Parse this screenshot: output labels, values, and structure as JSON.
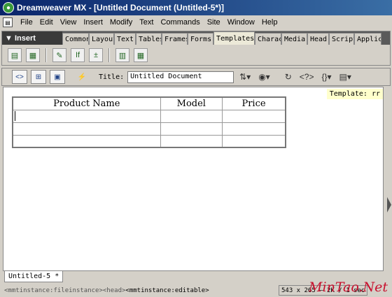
{
  "window": {
    "title": "Dreamweaver MX - [Untitled Document (Untitled-5*)]"
  },
  "menu": [
    "File",
    "Edit",
    "View",
    "Insert",
    "Modify",
    "Text",
    "Commands",
    "Site",
    "Window",
    "Help"
  ],
  "insert_panel": {
    "label": "Insert",
    "tabs": [
      "Common",
      "Layout",
      "Text",
      "Tables",
      "Frames",
      "Forms",
      "Templates",
      "Characters",
      "Media",
      "Head",
      "Script",
      "Application"
    ],
    "active_tab": "Templates",
    "icons": [
      "make-template-icon",
      "make-nested-template-icon",
      "editable-region-icon",
      "optional-region-icon",
      "repeating-region-icon",
      "editable-optional-region-icon",
      "repeating-table-icon"
    ]
  },
  "doc_toolbar": {
    "views": [
      "code-view-icon",
      "split-view-icon",
      "design-view-icon"
    ],
    "title_label": "Title:",
    "title_value": "Untitled Document"
  },
  "document": {
    "template_label": "Template: rr",
    "table": {
      "headers": [
        "Product Name",
        "Model",
        "Price"
      ],
      "rows": [
        [
          "",
          "",
          ""
        ],
        [
          "",
          "",
          ""
        ],
        [
          "",
          "",
          ""
        ]
      ]
    }
  },
  "doc_tab": "Untitled-5 *",
  "status": {
    "tags": [
      "<mmtinstance:fileinstance>",
      "<head>",
      "<mmtinstance:editable>"
    ],
    "size": "543 x 265 — 2K / 1 sec",
    "watermark": "MinTao.Net"
  }
}
